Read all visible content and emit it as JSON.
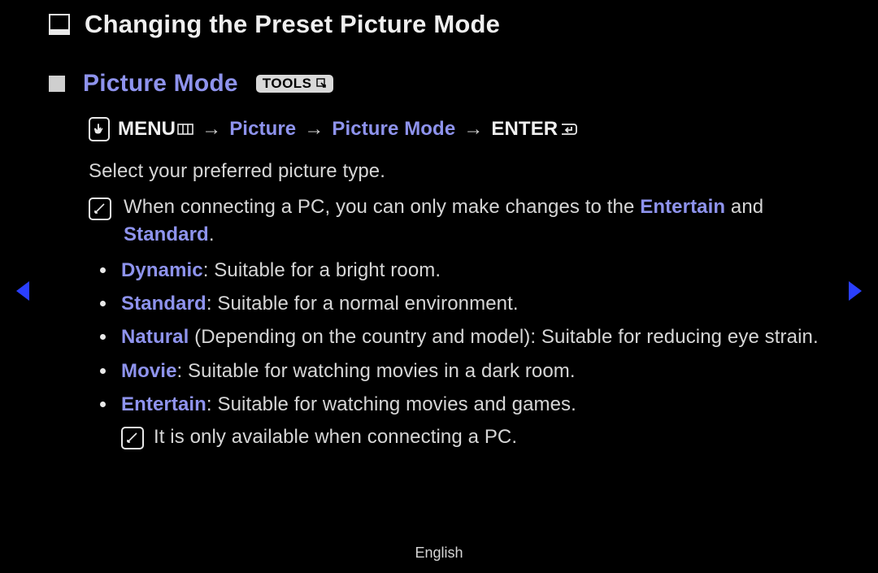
{
  "title": "Changing the Preset Picture Mode",
  "subtitle": "Picture Mode",
  "tools_label": "TOOLS",
  "nav": {
    "menu": "MENU",
    "p1": "Picture",
    "p2": "Picture Mode",
    "enter": "ENTER",
    "arrow": "→"
  },
  "intro": "Select your preferred picture type.",
  "note1": {
    "pre": "When connecting a PC, you can only make changes to the ",
    "hl1": "Entertain",
    "mid": " and ",
    "hl2": "Standard",
    "post": "."
  },
  "modes": [
    {
      "name": "Dynamic",
      "qualifier": "",
      "desc": ": Suitable for a bright room."
    },
    {
      "name": "Standard",
      "qualifier": "",
      "desc": ": Suitable for a normal environment."
    },
    {
      "name": "Natural",
      "qualifier": " (Depending on the country and model)",
      "desc": ": Suitable for reducing eye strain."
    },
    {
      "name": "Movie",
      "qualifier": "",
      "desc": ": Suitable for watching movies in a dark room."
    },
    {
      "name": "Entertain",
      "qualifier": "",
      "desc": ": Suitable for watching movies and games."
    }
  ],
  "entertain_subnote": "It is only available when connecting a PC.",
  "footer": "English"
}
